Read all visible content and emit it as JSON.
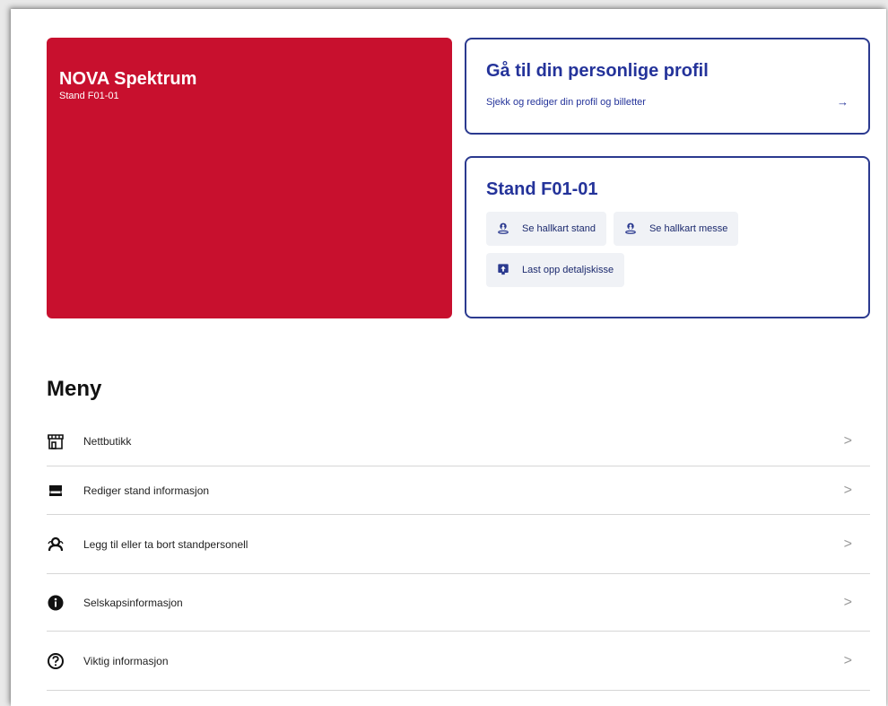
{
  "hero": {
    "title": "NOVA Spektrum",
    "subtitle": "Stand F01-01",
    "color": "#c8102e"
  },
  "profile_card": {
    "title": "Gå til din personlige profil",
    "description": "Sjekk og rediger din profil og billetter",
    "arrow": "→"
  },
  "stand_card": {
    "title": "Stand F01-01",
    "buttons": [
      {
        "label": "Se hallkart stand",
        "icon": "map-pin-person-icon"
      },
      {
        "label": "Se hallkart messe",
        "icon": "map-pin-person-icon"
      },
      {
        "label": "Last opp detaljskisse",
        "icon": "upload-icon"
      }
    ]
  },
  "menu": {
    "title": "Meny",
    "items": [
      {
        "label": "Nettbutikk",
        "icon": "store-icon"
      },
      {
        "label": "Rediger stand informasjon",
        "icon": "stand-icon"
      },
      {
        "label": "Legg til eller ta bort standpersonell",
        "icon": "people-icon"
      },
      {
        "label": "Selskapsinformasjon",
        "icon": "info-icon"
      },
      {
        "label": "Viktig informasjon",
        "icon": "help-icon"
      }
    ],
    "chevron": ">"
  },
  "colors": {
    "brand_red": "#c8102e",
    "accent_blue": "#24339a",
    "chip_bg": "#f0f2f6"
  }
}
